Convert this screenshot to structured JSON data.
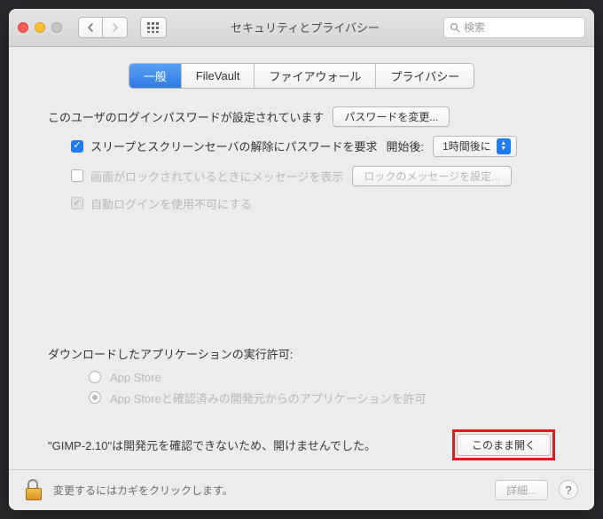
{
  "window": {
    "title": "セキュリティとプライバシー"
  },
  "search": {
    "placeholder": "検索"
  },
  "tabs": {
    "general": "一般",
    "filevault": "FileVault",
    "firewall": "ファイアウォール",
    "privacy": "プライバシー"
  },
  "login": {
    "status": "このユーザのログインパスワードが設定されています",
    "change_btn": "パスワードを変更...",
    "sleep_cb": "スリープとスクリーンセーバの解除にパスワードを要求",
    "after_label": "開始後:",
    "after_value": "1時間後に",
    "lock_msg_cb": "画面がロックされているときにメッセージを表示",
    "lock_msg_btn": "ロックのメッセージを設定...",
    "autologin_cb": "自動ログインを使用不可にする"
  },
  "download": {
    "heading": "ダウンロードしたアプリケーションの実行許可:",
    "opt_appstore": "App Store",
    "opt_identified": "App Storeと確認済みの開発元からのアプリケーションを許可",
    "warn": "\"GIMP-2.10\"は開発元を確認できないため、開けませんでした。",
    "open_btn": "このまま開く"
  },
  "footer": {
    "text": "変更するにはカギをクリックします。",
    "detail_btn": "詳細...",
    "help": "?"
  }
}
